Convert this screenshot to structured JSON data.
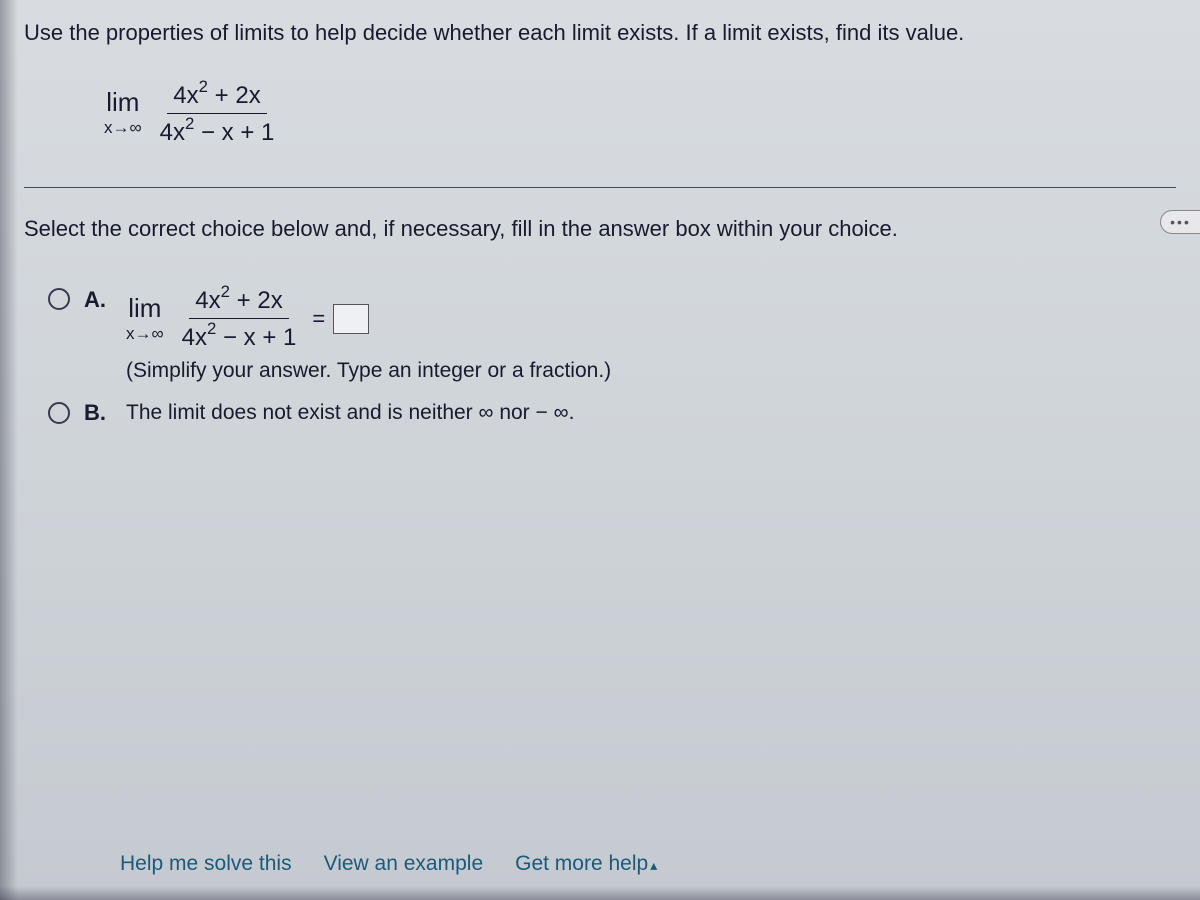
{
  "question": {
    "prompt": "Use the properties of limits to help decide whether each limit exists. If a limit exists, find its value.",
    "limit": {
      "lim_label": "lim",
      "approach": "x→∞",
      "numerator": "4x² + 2x",
      "denominator": "4x² − x + 1"
    },
    "select_text": "Select the correct choice below and, if necessary, fill in the answer box within your choice."
  },
  "choices": {
    "a": {
      "label": "A.",
      "lim_label": "lim",
      "approach": "x→∞",
      "numerator": "4x² + 2x",
      "denominator": "4x² − x + 1",
      "equals": "=",
      "hint": "(Simplify your answer. Type an integer or a fraction.)"
    },
    "b": {
      "label": "B.",
      "text": "The limit does not exist and is neither ∞ nor − ∞."
    }
  },
  "footer": {
    "help": "Help me solve this",
    "example": "View an example",
    "more_help": "Get more help"
  },
  "more_dots": "•••"
}
